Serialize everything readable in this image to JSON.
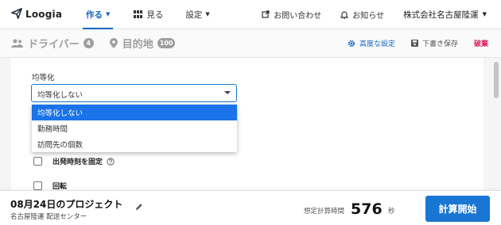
{
  "app": {
    "logo_text": "Loogia"
  },
  "nav": {
    "create_label": "作る",
    "view_label": "見る",
    "settings_label": "設定",
    "contact_label": "お問い合わせ",
    "news_label": "お知らせ",
    "company_label": "株式会社名古屋陸運"
  },
  "subheader": {
    "driver_label": "ドライバー",
    "driver_count": "4",
    "destination_label": "目的地",
    "destination_count": "100",
    "advanced_label": "高度な設定",
    "draft_label": "下書き保存",
    "discard_label": "破棄"
  },
  "form": {
    "equalize_label": "均等化",
    "equalize_value": "均等化しない",
    "options": [
      "均等化しない",
      "勤務時間",
      "訪問先の個数"
    ],
    "fixed_departure_label": "出発時刻を固定",
    "rotation_label": "回転"
  },
  "footer": {
    "project_title": "08月24日のプロジェクト",
    "project_subtitle": "名古屋陸運 配送センター",
    "estimate_label": "想定計算時間",
    "estimate_value": "576",
    "estimate_unit": "秒",
    "start_label": "計算開始"
  },
  "colors": {
    "accent": "#1976d2",
    "discard": "#d81b60",
    "selected_option": "#1a73e8"
  },
  "icons": {
    "logo": "paper-plane-icon",
    "view": "grid-icon",
    "contact": "external-link-icon",
    "news": "bell-icon",
    "driver": "people-icon",
    "destination": "map-pin-icon",
    "advanced": "gear-icon",
    "draft": "save-icon",
    "help": "help-circle-icon",
    "edit": "pencil-icon"
  }
}
